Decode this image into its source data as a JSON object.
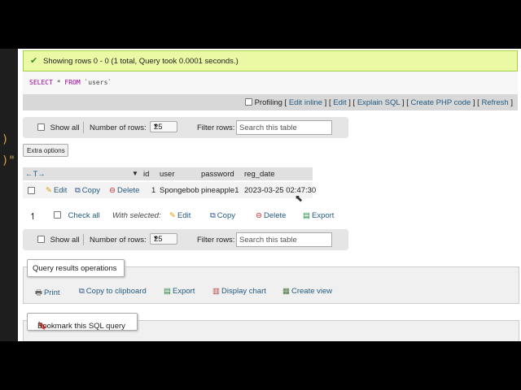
{
  "editor": {
    "glyph_1": ")",
    "glyph_2": ")\""
  },
  "success": {
    "message": "Showing rows 0 - 0 (1 total, Query took 0.0001 seconds.)"
  },
  "sql": {
    "keyword_select": "SELECT",
    "star": "*",
    "keyword_from": "FROM",
    "table": "`users`"
  },
  "tools": {
    "profiling": "Profiling",
    "links": [
      "Edit inline",
      "Edit",
      "Explain SQL",
      "Create PHP code",
      "Refresh"
    ]
  },
  "nav_top": {
    "show_all": "Show all",
    "rows_label": "Number of rows:",
    "rows_value": "25",
    "filter_label": "Filter rows:",
    "filter_placeholder": "Search this table"
  },
  "extra_options": "Extra options",
  "table": {
    "arrows": "←T→",
    "sort_icon": "▼",
    "columns": [
      "id",
      "user",
      "password",
      "reg_date"
    ],
    "row": {
      "edit": "Edit",
      "copy": "Copy",
      "delete": "Delete",
      "id": "1",
      "user": "Spongebob",
      "password": "pineapple1",
      "reg_date": "2023-03-25 02:47:30"
    }
  },
  "with_selected": {
    "check_all": "Check all",
    "label": "With selected:",
    "edit": "Edit",
    "copy": "Copy",
    "delete": "Delete",
    "export": "Export"
  },
  "nav_bottom": {
    "show_all": "Show all",
    "rows_label": "Number of rows:",
    "rows_value": "25",
    "filter_label": "Filter rows:",
    "filter_placeholder": "Search this table"
  },
  "query_ops": {
    "title": "Query results operations",
    "items": [
      "Print",
      "Copy to clipboard",
      "Export",
      "Display chart",
      "Create view"
    ]
  },
  "bookmark": {
    "title": "Bookmark this SQL query"
  },
  "colors": {
    "success_bg": "#ebf8a4",
    "link": "#235a81",
    "toolbar_bg": "#e5e5e5"
  }
}
